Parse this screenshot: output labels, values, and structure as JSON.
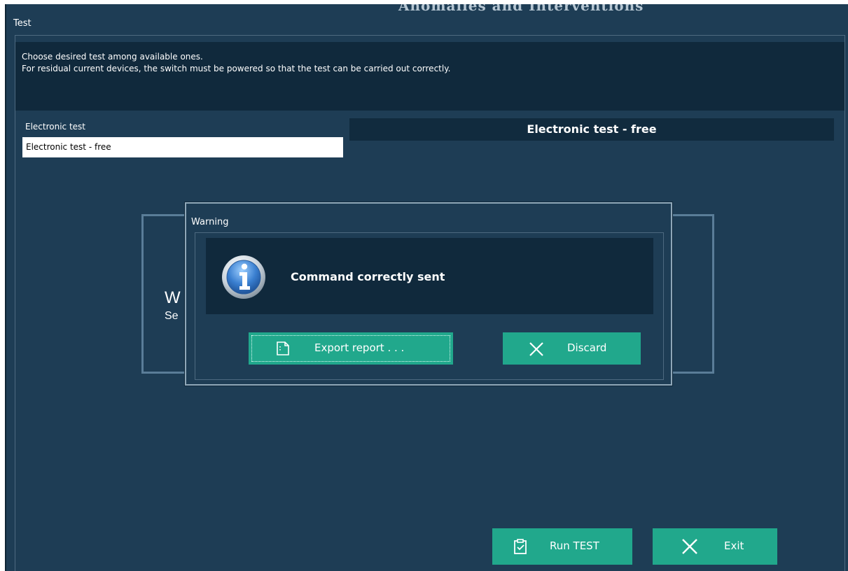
{
  "background_window": {
    "partial_title_above": "Anomalies and Interventions"
  },
  "window": {
    "title": "Test"
  },
  "info": {
    "line1": "Choose desired test among available ones.",
    "line2": "For residual current devices, the switch must be powered so that the test can be carried out correctly."
  },
  "test_list": {
    "group_label": "Electronic test",
    "items": [
      {
        "label": "Electronic test - free",
        "selected": true
      }
    ]
  },
  "selected_test_heading": "Electronic test - free",
  "background_panel": {
    "partial_heading": "W",
    "partial_subtext": "Se"
  },
  "dialog": {
    "title": "Warning",
    "icon": "info-icon",
    "message": "Command correctly sent",
    "export_button": {
      "label": "Export report . . .",
      "icon": "document-icon"
    },
    "discard_button": {
      "label": "Discard",
      "icon": "close-icon"
    }
  },
  "footer": {
    "run_button": {
      "label": "Run TEST",
      "icon": "clipboard-check-icon"
    },
    "exit_button": {
      "label": "Exit",
      "icon": "close-icon"
    }
  },
  "colors": {
    "window_bg": "#1e3d55",
    "panel_dark": "#10293c",
    "accent_button": "#21a88c",
    "text": "#ffffff"
  }
}
